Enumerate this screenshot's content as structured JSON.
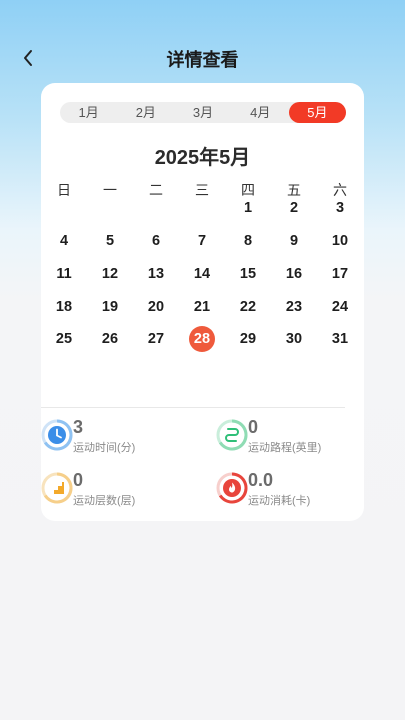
{
  "header": {
    "title": "详情查看",
    "back_icon": "chevron-left-icon"
  },
  "month_tabs": [
    {
      "label": "1月",
      "active": false
    },
    {
      "label": "2月",
      "active": false
    },
    {
      "label": "3月",
      "active": false
    },
    {
      "label": "4月",
      "active": false
    },
    {
      "label": "5月",
      "active": true
    }
  ],
  "calendar": {
    "title": "2025年5月",
    "weekdays": [
      "日",
      "一",
      "二",
      "三",
      "四",
      "五",
      "六"
    ],
    "first_weekday_index": 4,
    "days_in_month": 31,
    "today": 28
  },
  "stats": [
    {
      "value": "3",
      "label": "运动时间(分)",
      "icon": "clock-icon",
      "color": "#3b8ee8",
      "ring": "#8fc2f2"
    },
    {
      "value": "0",
      "label": "运动路程(英里)",
      "icon": "route-icon",
      "color": "#2fbf78",
      "ring": "#8fdcb4"
    },
    {
      "value": "0",
      "label": "运动层数(层)",
      "icon": "stairs-icon",
      "color": "#f3a92a",
      "ring": "#f6cf8a"
    },
    {
      "value": "0.0",
      "label": "运动消耗(卡)",
      "icon": "flame-icon",
      "color": "#e8453c",
      "ring": "#f0938d"
    }
  ],
  "colors": {
    "accent": "#f23a26",
    "today": "#ef5a3c"
  }
}
